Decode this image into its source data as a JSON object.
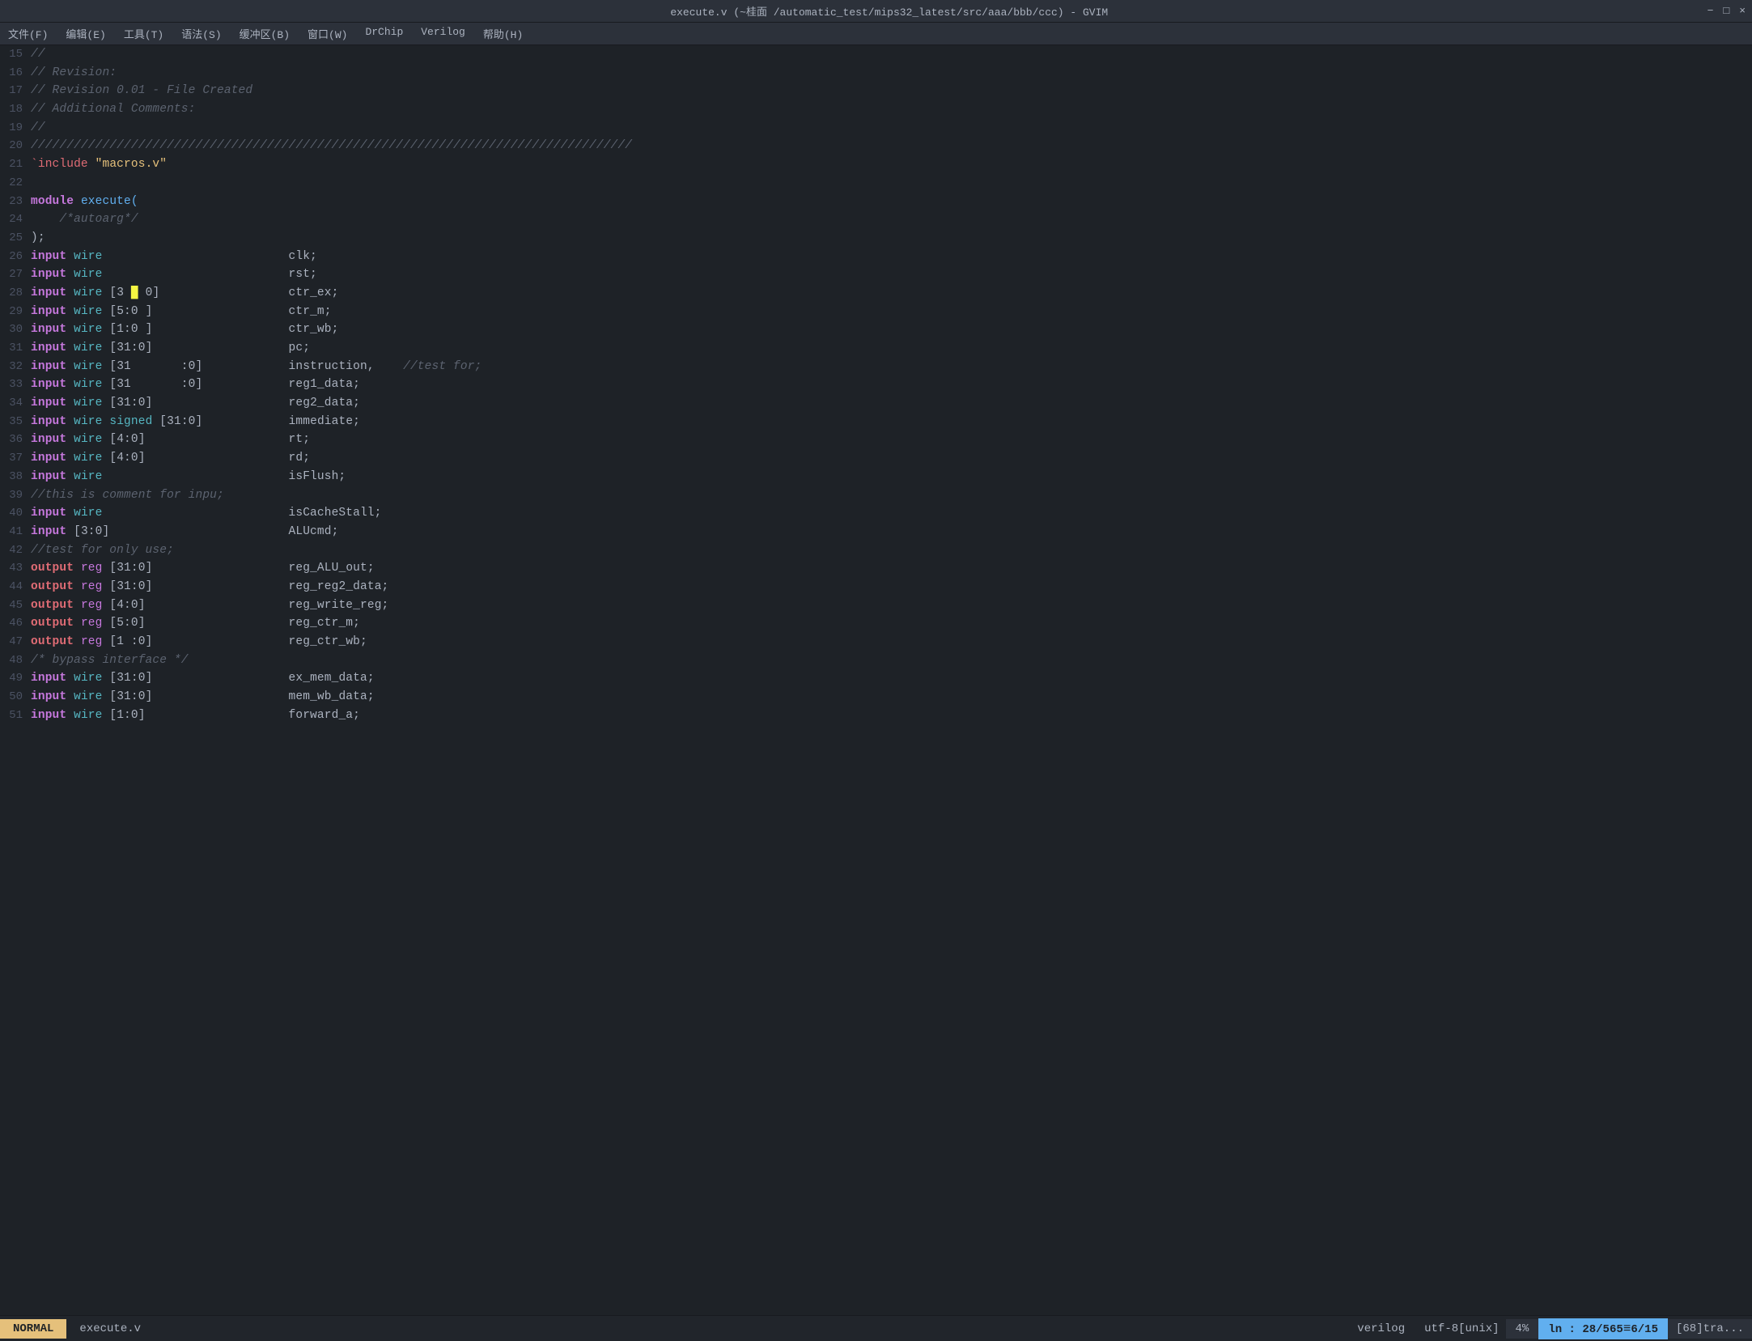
{
  "titleBar": {
    "title": "execute.v (~桂面 /automatic_test/mips32_latest/src/aaa/bbb/ccc) - GVIM",
    "minimize": "−",
    "maximize": "□",
    "close": "×"
  },
  "menuBar": {
    "items": [
      "文件(F)",
      "编辑(E)",
      "工具(T)",
      "语法(S)",
      "缓冲区(B)",
      "窗口(W)",
      "DrChip",
      "Verilog",
      "帮助(H)"
    ]
  },
  "lines": [
    {
      "num": "15",
      "content": "//",
      "tokens": [
        {
          "type": "comment",
          "text": "//"
        }
      ]
    },
    {
      "num": "16",
      "content": "// Revision:",
      "tokens": [
        {
          "type": "comment",
          "text": "// Revision:"
        }
      ]
    },
    {
      "num": "17",
      "content": "// Revision 0.01 - File Created",
      "tokens": [
        {
          "type": "comment",
          "text": "// Revision 0.01 - File Created"
        }
      ]
    },
    {
      "num": "18",
      "content": "// Additional Comments:",
      "tokens": [
        {
          "type": "comment",
          "text": "// Additional Comments:"
        }
      ]
    },
    {
      "num": "19",
      "content": "//",
      "tokens": [
        {
          "type": "comment",
          "text": "//"
        }
      ]
    },
    {
      "num": "20",
      "content": "////////////////////////////////////////////////////////////////////////////////////",
      "tokens": [
        {
          "type": "comment",
          "text": "////////////////////////////////////////////////////////////////////////////////////"
        }
      ]
    },
    {
      "num": "21",
      "content": "`include \"macros.v\"",
      "tokens": [
        {
          "type": "include",
          "text": "`include"
        },
        {
          "type": "space",
          "text": " "
        },
        {
          "type": "string",
          "text": "\"macros.v\""
        }
      ]
    },
    {
      "num": "22",
      "content": "",
      "tokens": []
    },
    {
      "num": "23",
      "content": "module execute(",
      "tokens": [
        {
          "type": "keyword",
          "text": "module"
        },
        {
          "type": "module",
          "text": " execute("
        }
      ]
    },
    {
      "num": "24",
      "content": "    /*autoarg*/",
      "tokens": [
        {
          "type": "space",
          "text": "    "
        },
        {
          "type": "comment",
          "text": "/*autoarg*/"
        }
      ]
    },
    {
      "num": "25",
      "content": ");",
      "tokens": [
        {
          "type": "port",
          "text": ");"
        }
      ]
    },
    {
      "num": "26",
      "content": "input wire                          clk;",
      "tokens": [
        {
          "type": "keyword",
          "text": "input"
        },
        {
          "type": "space",
          "text": " "
        },
        {
          "type": "wire",
          "text": "wire"
        },
        {
          "type": "spaces",
          "text": "                          "
        },
        {
          "type": "port",
          "text": "clk;"
        }
      ]
    },
    {
      "num": "27",
      "content": "input wire                          rst;",
      "tokens": [
        {
          "type": "keyword",
          "text": "input"
        },
        {
          "type": "space",
          "text": " "
        },
        {
          "type": "wire",
          "text": "wire"
        },
        {
          "type": "spaces",
          "text": "                          "
        },
        {
          "type": "port",
          "text": "rst;"
        }
      ]
    },
    {
      "num": "28",
      "content": "input wire [3 █ 0]                  ctr_ex;",
      "tokens": [
        {
          "type": "keyword",
          "text": "input"
        },
        {
          "type": "space",
          "text": " "
        },
        {
          "type": "wire",
          "text": "wire"
        },
        {
          "type": "space",
          "text": " "
        },
        {
          "type": "port",
          "text": "[3 "
        },
        {
          "type": "cursor",
          "text": "█"
        },
        {
          "type": "port",
          "text": " 0]"
        },
        {
          "type": "spaces",
          "text": "                  "
        },
        {
          "type": "port",
          "text": "ctr_ex;"
        }
      ]
    },
    {
      "num": "29",
      "content": "input wire [5:0 ]                   ctr_m;",
      "tokens": [
        {
          "type": "keyword",
          "text": "input"
        },
        {
          "type": "space",
          "text": " "
        },
        {
          "type": "wire",
          "text": "wire"
        },
        {
          "type": "space",
          "text": " "
        },
        {
          "type": "port",
          "text": "[5:0 ]"
        },
        {
          "type": "spaces",
          "text": "                   "
        },
        {
          "type": "port",
          "text": "ctr_m;"
        }
      ]
    },
    {
      "num": "30",
      "content": "input wire [1:0 ]                   ctr_wb;",
      "tokens": [
        {
          "type": "keyword",
          "text": "input"
        },
        {
          "type": "space",
          "text": " "
        },
        {
          "type": "wire",
          "text": "wire"
        },
        {
          "type": "space",
          "text": " "
        },
        {
          "type": "port",
          "text": "[1:0 ]"
        },
        {
          "type": "spaces",
          "text": "                   "
        },
        {
          "type": "port",
          "text": "ctr_wb;"
        }
      ]
    },
    {
      "num": "31",
      "content": "input wire [31:0]                   pc;",
      "tokens": [
        {
          "type": "keyword",
          "text": "input"
        },
        {
          "type": "space",
          "text": " "
        },
        {
          "type": "wire",
          "text": "wire"
        },
        {
          "type": "space",
          "text": " "
        },
        {
          "type": "port",
          "text": "[31:0]"
        },
        {
          "type": "spaces",
          "text": "                   "
        },
        {
          "type": "port",
          "text": "pc;"
        }
      ]
    },
    {
      "num": "32",
      "content": "input wire [31       :0]            instruction,    //test for;",
      "tokens": [
        {
          "type": "keyword",
          "text": "input"
        },
        {
          "type": "space",
          "text": " "
        },
        {
          "type": "wire",
          "text": "wire"
        },
        {
          "type": "space",
          "text": " "
        },
        {
          "type": "port",
          "text": "[31       :0]"
        },
        {
          "type": "spaces",
          "text": "            "
        },
        {
          "type": "port",
          "text": "instruction,"
        },
        {
          "type": "spaces",
          "text": "    "
        },
        {
          "type": "comment",
          "text": "//test for;"
        }
      ]
    },
    {
      "num": "33",
      "content": "input wire [31       :0]            reg1_data;",
      "tokens": [
        {
          "type": "keyword",
          "text": "input"
        },
        {
          "type": "space",
          "text": " "
        },
        {
          "type": "wire",
          "text": "wire"
        },
        {
          "type": "space",
          "text": " "
        },
        {
          "type": "port",
          "text": "[31       :0]"
        },
        {
          "type": "spaces",
          "text": "            "
        },
        {
          "type": "port",
          "text": "reg1_data;"
        }
      ]
    },
    {
      "num": "34",
      "content": "input wire [31:0]                   reg2_data;",
      "tokens": [
        {
          "type": "keyword",
          "text": "input"
        },
        {
          "type": "space",
          "text": " "
        },
        {
          "type": "wire",
          "text": "wire"
        },
        {
          "type": "space",
          "text": " "
        },
        {
          "type": "port",
          "text": "[31:0]"
        },
        {
          "type": "spaces",
          "text": "                   "
        },
        {
          "type": "port",
          "text": "reg2_data;"
        }
      ]
    },
    {
      "num": "35",
      "content": "input wire signed [31:0]            immediate;",
      "tokens": [
        {
          "type": "keyword",
          "text": "input"
        },
        {
          "type": "space",
          "text": " "
        },
        {
          "type": "wire",
          "text": "wire"
        },
        {
          "type": "space",
          "text": " "
        },
        {
          "type": "signed",
          "text": "signed"
        },
        {
          "type": "space",
          "text": " "
        },
        {
          "type": "port",
          "text": "[31:0]"
        },
        {
          "type": "spaces",
          "text": "            "
        },
        {
          "type": "port",
          "text": "immediate;"
        }
      ]
    },
    {
      "num": "36",
      "content": "input wire [4:0]                    rt;",
      "tokens": [
        {
          "type": "keyword",
          "text": "input"
        },
        {
          "type": "space",
          "text": " "
        },
        {
          "type": "wire",
          "text": "wire"
        },
        {
          "type": "space",
          "text": " "
        },
        {
          "type": "port",
          "text": "[4:0]"
        },
        {
          "type": "spaces",
          "text": "                    "
        },
        {
          "type": "port",
          "text": "rt;"
        }
      ]
    },
    {
      "num": "37",
      "content": "input wire [4:0]                    rd;",
      "tokens": [
        {
          "type": "keyword",
          "text": "input"
        },
        {
          "type": "space",
          "text": " "
        },
        {
          "type": "wire",
          "text": "wire"
        },
        {
          "type": "space",
          "text": " "
        },
        {
          "type": "port",
          "text": "[4:0]"
        },
        {
          "type": "spaces",
          "text": "                    "
        },
        {
          "type": "port",
          "text": "rd;"
        }
      ]
    },
    {
      "num": "38",
      "content": "input wire                          isFlush;",
      "tokens": [
        {
          "type": "keyword",
          "text": "input"
        },
        {
          "type": "space",
          "text": " "
        },
        {
          "type": "wire",
          "text": "wire"
        },
        {
          "type": "spaces",
          "text": "                          "
        },
        {
          "type": "port",
          "text": "isFlush;"
        }
      ]
    },
    {
      "num": "39",
      "content": "//this is comment for inpu;",
      "tokens": [
        {
          "type": "comment",
          "text": "//this is comment for inpu;"
        }
      ]
    },
    {
      "num": "40",
      "content": "input wire                          isCacheStall;",
      "tokens": [
        {
          "type": "keyword",
          "text": "input"
        },
        {
          "type": "space",
          "text": " "
        },
        {
          "type": "wire",
          "text": "wire"
        },
        {
          "type": "spaces",
          "text": "                          "
        },
        {
          "type": "port",
          "text": "isCacheStall;"
        }
      ]
    },
    {
      "num": "41",
      "content": "input [3:0]                         ALUcmd;",
      "tokens": [
        {
          "type": "keyword",
          "text": "input"
        },
        {
          "type": "space",
          "text": " "
        },
        {
          "type": "port",
          "text": "[3:0]"
        },
        {
          "type": "spaces",
          "text": "                         "
        },
        {
          "type": "port",
          "text": "ALUcmd;"
        }
      ]
    },
    {
      "num": "42",
      "content": "//test for only use;",
      "tokens": [
        {
          "type": "comment",
          "text": "//test for only use;"
        }
      ]
    },
    {
      "num": "43",
      "content": "output reg [31:0]                   reg_ALU_out;",
      "tokens": [
        {
          "type": "output",
          "text": "output"
        },
        {
          "type": "space",
          "text": " "
        },
        {
          "type": "reg",
          "text": "reg"
        },
        {
          "type": "space",
          "text": " "
        },
        {
          "type": "port",
          "text": "[31:0]"
        },
        {
          "type": "spaces",
          "text": "                   "
        },
        {
          "type": "port",
          "text": "reg_ALU_out;"
        }
      ]
    },
    {
      "num": "44",
      "content": "output reg [31:0]                   reg_reg2_data;",
      "tokens": [
        {
          "type": "output",
          "text": "output"
        },
        {
          "type": "space",
          "text": " "
        },
        {
          "type": "reg",
          "text": "reg"
        },
        {
          "type": "space",
          "text": " "
        },
        {
          "type": "port",
          "text": "[31:0]"
        },
        {
          "type": "spaces",
          "text": "                   "
        },
        {
          "type": "port",
          "text": "reg_reg2_data;"
        }
      ]
    },
    {
      "num": "45",
      "content": "output reg [4:0]                    reg_write_reg;",
      "tokens": [
        {
          "type": "output",
          "text": "output"
        },
        {
          "type": "space",
          "text": " "
        },
        {
          "type": "reg",
          "text": "reg"
        },
        {
          "type": "space",
          "text": " "
        },
        {
          "type": "port",
          "text": "[4:0]"
        },
        {
          "type": "spaces",
          "text": "                    "
        },
        {
          "type": "port",
          "text": "reg_write_reg;"
        }
      ]
    },
    {
      "num": "46",
      "content": "output reg [5:0]                    reg_ctr_m;",
      "tokens": [
        {
          "type": "output",
          "text": "output"
        },
        {
          "type": "space",
          "text": " "
        },
        {
          "type": "reg",
          "text": "reg"
        },
        {
          "type": "space",
          "text": " "
        },
        {
          "type": "port",
          "text": "[5:0]"
        },
        {
          "type": "spaces",
          "text": "                    "
        },
        {
          "type": "port",
          "text": "reg_ctr_m;"
        }
      ]
    },
    {
      "num": "47",
      "content": "output reg [1 :0]                   reg_ctr_wb;",
      "tokens": [
        {
          "type": "output",
          "text": "output"
        },
        {
          "type": "space",
          "text": " "
        },
        {
          "type": "reg",
          "text": "reg"
        },
        {
          "type": "space",
          "text": " "
        },
        {
          "type": "port",
          "text": "[1 :0]"
        },
        {
          "type": "spaces",
          "text": "                   "
        },
        {
          "type": "port",
          "text": "reg_ctr_wb;"
        }
      ]
    },
    {
      "num": "48",
      "content": "/* bypass interface */",
      "tokens": [
        {
          "type": "comment",
          "text": "/* bypass interface */"
        }
      ]
    },
    {
      "num": "49",
      "content": "input wire [31:0]                   ex_mem_data;",
      "tokens": [
        {
          "type": "keyword",
          "text": "input"
        },
        {
          "type": "space",
          "text": " "
        },
        {
          "type": "wire",
          "text": "wire"
        },
        {
          "type": "space",
          "text": " "
        },
        {
          "type": "port",
          "text": "[31:0]"
        },
        {
          "type": "spaces",
          "text": "                   "
        },
        {
          "type": "port",
          "text": "ex_mem_data;"
        }
      ]
    },
    {
      "num": "50",
      "content": "input wire [31:0]                   mem_wb_data;",
      "tokens": [
        {
          "type": "keyword",
          "text": "input"
        },
        {
          "type": "space",
          "text": " "
        },
        {
          "type": "wire",
          "text": "wire"
        },
        {
          "type": "space",
          "text": " "
        },
        {
          "type": "port",
          "text": "[31:0]"
        },
        {
          "type": "spaces",
          "text": "                   "
        },
        {
          "type": "port",
          "text": "mem_wb_data;"
        }
      ]
    },
    {
      "num": "51",
      "content": "input wire [1:0]                    forward_a;",
      "tokens": [
        {
          "type": "keyword",
          "text": "input"
        },
        {
          "type": "space",
          "text": " "
        },
        {
          "type": "wire",
          "text": "wire"
        },
        {
          "type": "space",
          "text": " "
        },
        {
          "type": "port",
          "text": "[1:0]"
        },
        {
          "type": "spaces",
          "text": "                    "
        },
        {
          "type": "port",
          "text": "forward_a;"
        }
      ]
    }
  ],
  "statusBar": {
    "mode": "NORMAL",
    "filename": "execute.v",
    "filetype": "verilog",
    "encoding": "utf-8[unix]",
    "percent": "4%",
    "position": "ln : 28/565",
    "col": "6/15",
    "extra": "[68]tra..."
  },
  "colors": {
    "bg": "#1e2227",
    "comment": "#5c6370",
    "keyword": "#c678dd",
    "wire": "#56b6c2",
    "string": "#e5c07b",
    "include": "#e06c75",
    "output": "#e06c75",
    "reg": "#c678dd",
    "signed": "#56b6c2",
    "module": "#61afef",
    "port": "#abb2bf",
    "cursor_bg": "#f5f542",
    "statusMode_bg": "#e5c07b",
    "statusPos_bg": "#61afef",
    "linenum": "#4b5263"
  }
}
